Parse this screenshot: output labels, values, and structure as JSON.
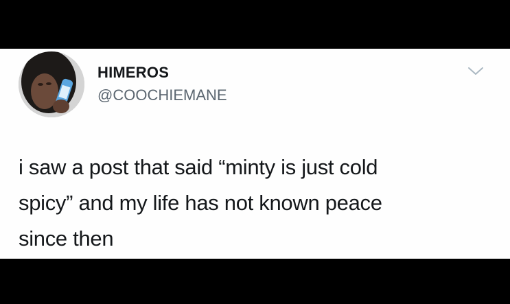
{
  "tweet": {
    "author": {
      "display_name": "HIMEROS",
      "handle": "@COOCHIEMANE",
      "avatar_icon": "profile-photo"
    },
    "menu_icon": "chevron-down-icon",
    "text_lines": [
      "i saw a post that said “minty is just cold",
      "spicy” and my life has not known peace",
      "since then"
    ]
  },
  "colors": {
    "background": "#000000",
    "card": "#fefefe",
    "text": "#14171a",
    "secondary_text": "#5b6670",
    "chevron": "#aab8c2"
  }
}
